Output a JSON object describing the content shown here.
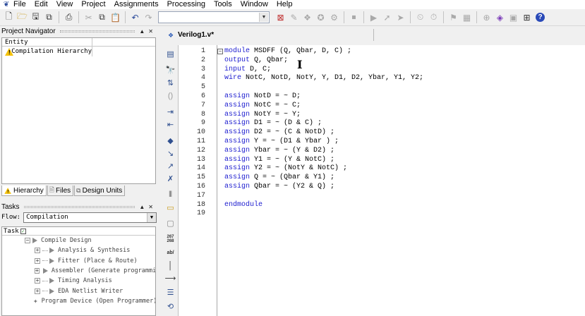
{
  "menu": [
    "File",
    "Edit",
    "View",
    "Project",
    "Assignments",
    "Processing",
    "Tools",
    "Window",
    "Help"
  ],
  "toolbar": {
    "combo_value": ""
  },
  "project_navigator": {
    "title": "Project Navigator",
    "column_header": "Entity",
    "rows": [
      {
        "label": "Compilation Hierarchy",
        "icon": "warning-icon"
      }
    ],
    "tabs": [
      {
        "label": "Hierarchy",
        "icon": "warning-icon"
      },
      {
        "label": "Files",
        "icon": "file-icon"
      },
      {
        "label": "Design Units",
        "icon": "design-units-icon"
      }
    ]
  },
  "tasks": {
    "title": "Tasks",
    "flow_label": "Flow:",
    "flow_value": "Compilation",
    "column_header": "Task",
    "rows": [
      {
        "label": "Compile Design",
        "level": 0,
        "kind": "expand"
      },
      {
        "label": "Analysis & Synthesis",
        "level": 1,
        "kind": "expand"
      },
      {
        "label": "Fitter (Place & Route)",
        "level": 1,
        "kind": "expand"
      },
      {
        "label": "Assembler (Generate programmi",
        "level": 1,
        "kind": "expand"
      },
      {
        "label": "Timing Analysis",
        "level": 1,
        "kind": "expand"
      },
      {
        "label": "EDA Netlist Writer",
        "level": 1,
        "kind": "expand"
      },
      {
        "label": "Program Device (Open Programmer)",
        "level": 0,
        "kind": "program"
      }
    ]
  },
  "editor": {
    "tab_title": "Verilog1.v*",
    "side_text_button": "267\n268",
    "side_ab_button": "ab/",
    "lines": [
      {
        "n": "1",
        "kw": "module",
        "rest": " MSDFF (Q, Qbar, D, C) ;",
        "fold": true
      },
      {
        "n": "2",
        "kw": "output",
        "rest": " Q, Qbar;"
      },
      {
        "n": "3",
        "kw": "input",
        "rest": " D, C;"
      },
      {
        "n": "4",
        "kw": "wire",
        "rest": " NotC, NotD, NotY, Y, D1, D2, Ybar, Y1, Y2;"
      },
      {
        "n": "5",
        "kw": "",
        "rest": ""
      },
      {
        "n": "6",
        "kw": "assign",
        "rest": " NotD = ~ D;"
      },
      {
        "n": "7",
        "kw": "assign",
        "rest": " NotC = ~ C;"
      },
      {
        "n": "8",
        "kw": "assign",
        "rest": " NotY = ~ Y;"
      },
      {
        "n": "9",
        "kw": "assign",
        "rest": " D1 = ~ (D & C) ;"
      },
      {
        "n": "10",
        "kw": "assign",
        "rest": " D2 = ~ (C & NotD) ;"
      },
      {
        "n": "11",
        "kw": "assign",
        "rest": " Y = ~ (D1 & Ybar ) ;"
      },
      {
        "n": "12",
        "kw": "assign",
        "rest": " Ybar = ~ (Y & D2) ;"
      },
      {
        "n": "13",
        "kw": "assign",
        "rest": " Y1 = ~ (Y & NotC) ;"
      },
      {
        "n": "14",
        "kw": "assign",
        "rest": " Y2 = ~ (NotY & NotC) ;"
      },
      {
        "n": "15",
        "kw": "assign",
        "rest": " Q = ~ (Qbar & Y1) ;"
      },
      {
        "n": "16",
        "kw": "assign",
        "rest": " Qbar = ~ (Y2 & Q) ;"
      },
      {
        "n": "17",
        "kw": "",
        "rest": ""
      },
      {
        "n": "18",
        "kw": "endmodule",
        "rest": ""
      },
      {
        "n": "19",
        "kw": "",
        "rest": ""
      }
    ]
  },
  "colors": {
    "keyword": "#2020d0",
    "warning": "#f4c20d"
  }
}
